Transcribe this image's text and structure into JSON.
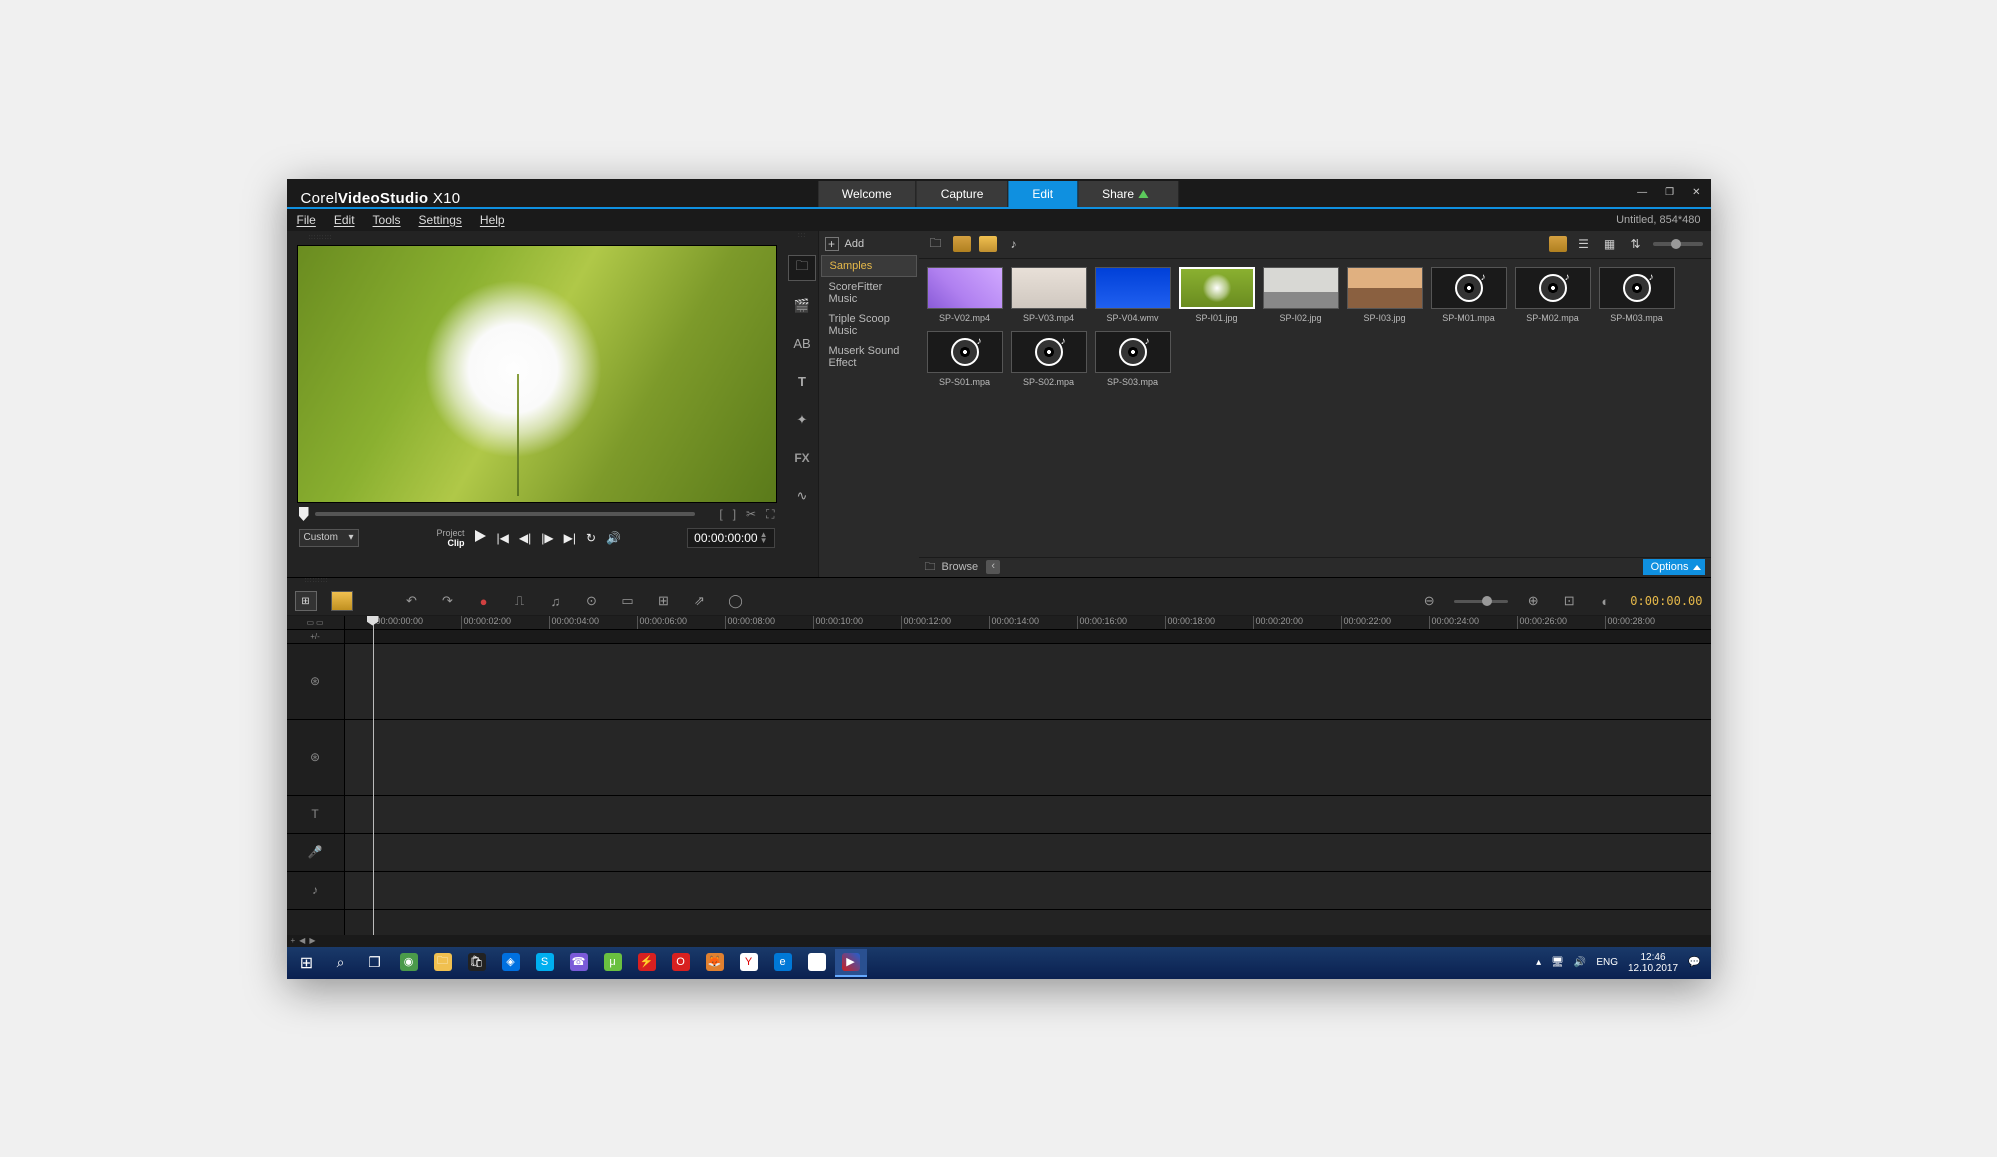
{
  "title": {
    "brand": "Corel",
    "product": "VideoStudio",
    "version": "X10"
  },
  "titleTabs": {
    "welcome": "Welcome",
    "capture": "Capture",
    "edit": "Edit",
    "share": "Share"
  },
  "winControls": {
    "min": "—",
    "max": "❐",
    "close": "✕"
  },
  "menu": {
    "file": "File",
    "edit": "Edit",
    "tools": "Tools",
    "settings": "Settings",
    "help": "Help",
    "rightInfo": "Untitled, 854*480"
  },
  "preview": {
    "customLabel": "Custom",
    "projectLabel": "Project",
    "clipLabel": "Clip",
    "timecode": "00:00:00:00"
  },
  "library": {
    "addLabel": "Add",
    "categories": {
      "samples": "Samples",
      "scorefitter": "ScoreFitter Music",
      "triplescoop": "Triple Scoop Music",
      "muserk": "Muserk Sound Effect"
    },
    "browseLabel": "Browse",
    "optionsLabel": "Options",
    "fxLabel": "FX",
    "items": [
      {
        "name": "SP-V02.mp4",
        "type": "v02"
      },
      {
        "name": "SP-V03.mp4",
        "type": "v03"
      },
      {
        "name": "SP-V04.wmv",
        "type": "v04"
      },
      {
        "name": "SP-I01.jpg",
        "type": "i01",
        "selected": true
      },
      {
        "name": "SP-I02.jpg",
        "type": "i02"
      },
      {
        "name": "SP-I03.jpg",
        "type": "i03"
      },
      {
        "name": "SP-M01.mpa",
        "type": "audio"
      },
      {
        "name": "SP-M02.mpa",
        "type": "audio"
      },
      {
        "name": "SP-M03.mpa",
        "type": "audio"
      },
      {
        "name": "SP-S01.mpa",
        "type": "audio"
      },
      {
        "name": "SP-S02.mpa",
        "type": "audio"
      },
      {
        "name": "SP-S03.mpa",
        "type": "audio"
      }
    ]
  },
  "timeline": {
    "timecode": "0:00:00.00",
    "ticks": [
      "00:00:00:00",
      "00:00:02:00",
      "00:00:04:00",
      "00:00:06:00",
      "00:00:08:00",
      "00:00:10:00",
      "00:00:12:00",
      "00:00:14:00",
      "00:00:16:00",
      "00:00:18:00",
      "00:00:20:00",
      "00:00:22:00",
      "00:00:24:00",
      "00:00:26:00",
      "00:00:28:00"
    ]
  },
  "taskbar": {
    "lang": "ENG",
    "time": "12:46",
    "date": "12.10.2017"
  }
}
